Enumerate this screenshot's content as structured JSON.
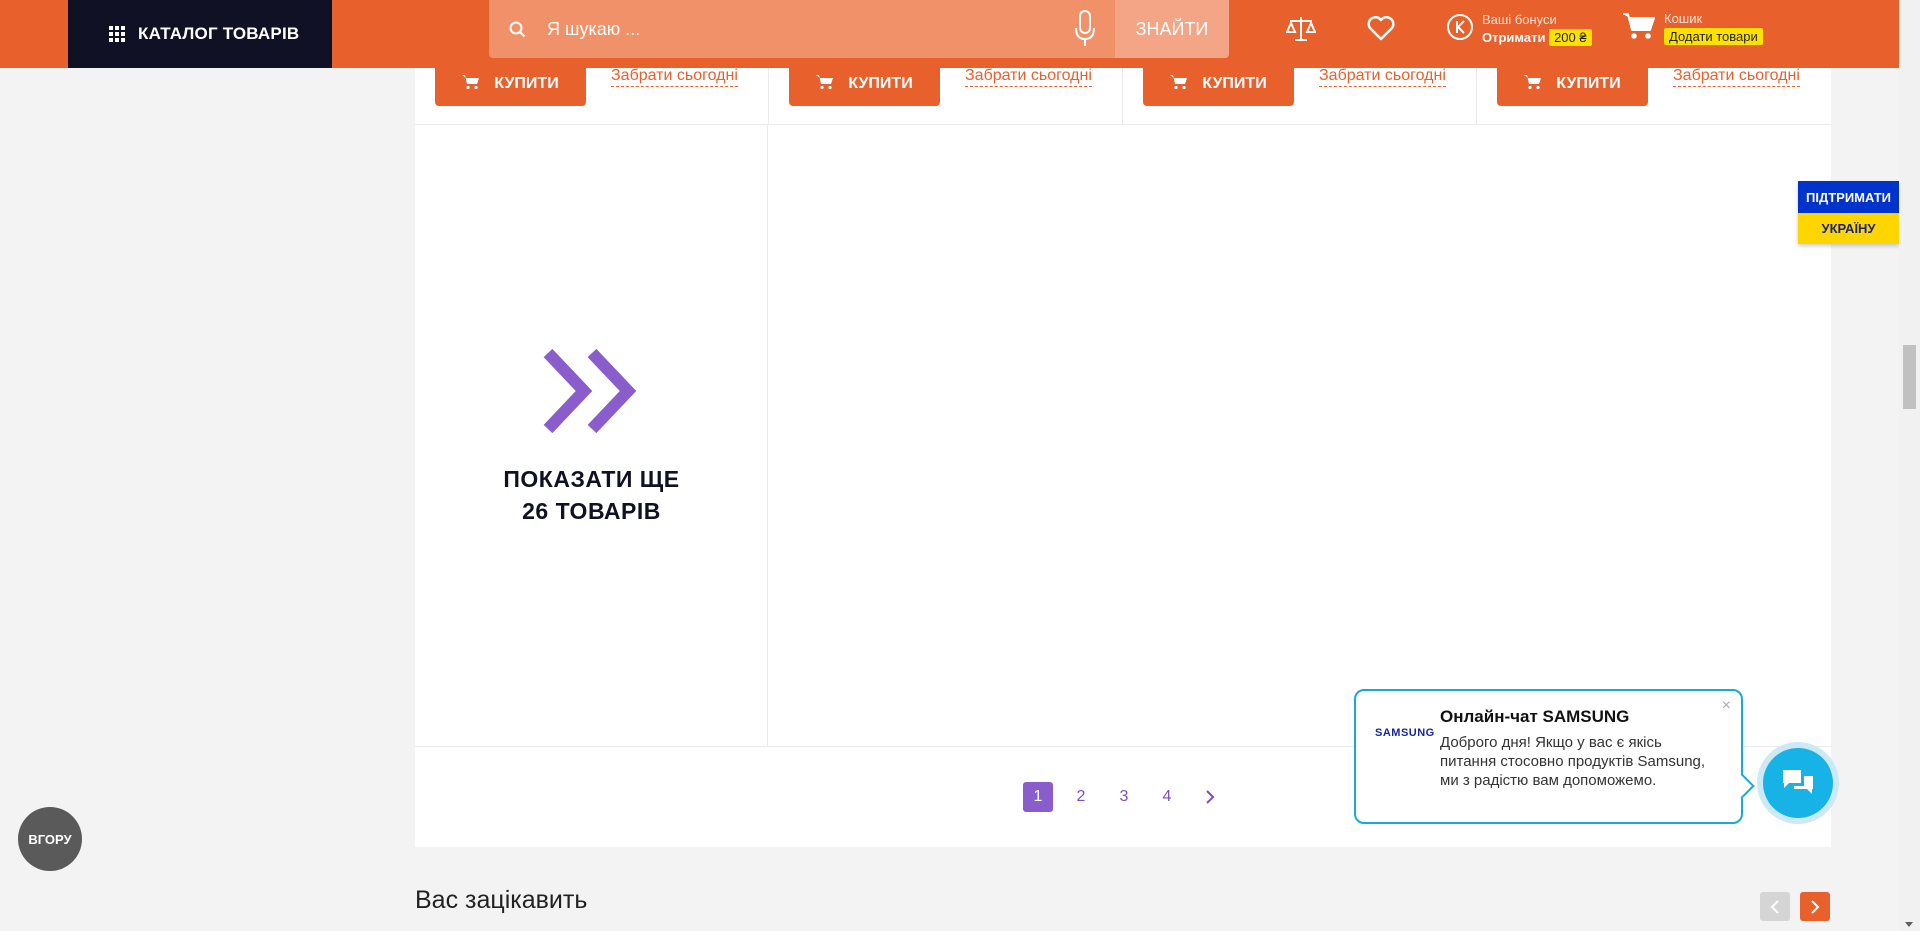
{
  "header": {
    "catalog_label": "КАТАЛОГ ТОВАРІВ",
    "search_placeholder": "Я шукаю ...",
    "search_button": "ЗНАЙТИ",
    "bonus_label": "Ваші бонуси",
    "bonus_action": "Отримати",
    "bonus_amount": "200 ₴",
    "cart_label": "Кошик",
    "cart_action": "Додати товари"
  },
  "product_cards": [
    {
      "buy_label": "КУПИТИ",
      "pickup_label": "Забрати сьогодні"
    },
    {
      "buy_label": "КУПИТИ",
      "pickup_label": "Забрати сьогодні"
    },
    {
      "buy_label": "КУПИТИ",
      "pickup_label": "Забрати сьогодні"
    },
    {
      "buy_label": "КУПИТИ",
      "pickup_label": "Забрати сьогодні"
    }
  ],
  "show_more": {
    "line1": "ПОКАЗАТИ ЩЕ",
    "line2": "26 ТОВАРІВ"
  },
  "pagination": {
    "pages": [
      "1",
      "2",
      "3",
      "4"
    ],
    "active": "1"
  },
  "section": {
    "title": "Вас зацікавить"
  },
  "support_ukraine": {
    "top": "ПІДТРИМАТИ",
    "bottom": "УКРАЇНУ"
  },
  "to_top": "ВГОРУ",
  "chat": {
    "brand": "SAMSUNG",
    "title": "Онлайн-чат SAMSUNG",
    "message": "Доброго дня! Якщо у вас є якісь питання стосовно продуктів Samsung, ми з радістю вам допоможемо.",
    "close": "×"
  },
  "colors": {
    "brand_orange": "#e8602c",
    "dark_navy": "#111125",
    "accent_purple": "#8a5dcd",
    "chat_blue": "#17b2e6"
  }
}
